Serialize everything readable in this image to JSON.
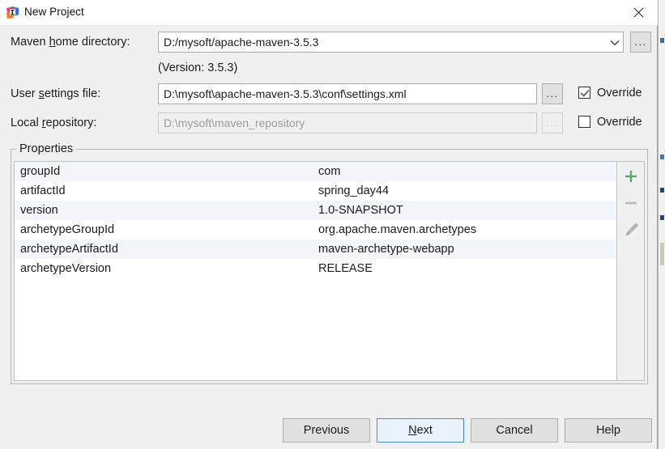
{
  "window": {
    "title": "New Project",
    "icon": "intellij-idea-icon",
    "close_icon": "close-icon"
  },
  "fields": {
    "maven_home": {
      "label_pre": "Maven ",
      "label_mn": "h",
      "label_post": "ome directory:",
      "value": "D:/mysoft/apache-maven-3.5.3",
      "dropdown_icon": "chevron-down-icon",
      "browse_label": "...",
      "version_note": "(Version: 3.5.3)"
    },
    "user_settings": {
      "label_pre": "User ",
      "label_mn": "s",
      "label_post": "ettings file:",
      "value": "D:\\mysoft\\apache-maven-3.5.3\\conf\\settings.xml",
      "browse_label": "...",
      "override_label": "Override",
      "override_checked": true
    },
    "local_repository": {
      "label_pre": "Local ",
      "label_mn": "r",
      "label_post": "epository:",
      "value": "D:\\mysoft\\maven_repository",
      "browse_label": "...",
      "override_label": "Override",
      "override_checked": false
    }
  },
  "properties_group": {
    "title": "Properties",
    "rows": [
      {
        "key": "groupId",
        "value": "com"
      },
      {
        "key": "artifactId",
        "value": "spring_day44"
      },
      {
        "key": "version",
        "value": "1.0-SNAPSHOT"
      },
      {
        "key": "archetypeGroupId",
        "value": "org.apache.maven.archetypes"
      },
      {
        "key": "archetypeArtifactId",
        "value": "maven-archetype-webapp"
      },
      {
        "key": "archetypeVersion",
        "value": "RELEASE"
      }
    ],
    "toolbar": {
      "add_icon": "plus-icon",
      "remove_icon": "minus-icon",
      "edit_icon": "pencil-icon"
    }
  },
  "buttons": {
    "previous": "Previous",
    "next_pre": "",
    "next_mn": "N",
    "next_post": "ext",
    "cancel": "Cancel",
    "help": "Help"
  },
  "colors": {
    "accent_green": "#59a869",
    "default_button_border": "#3d94d9",
    "default_button_fill": "#e8f3fd",
    "row_alt": "#f2f5f9",
    "dialog_bg": "#f0f0f0"
  }
}
